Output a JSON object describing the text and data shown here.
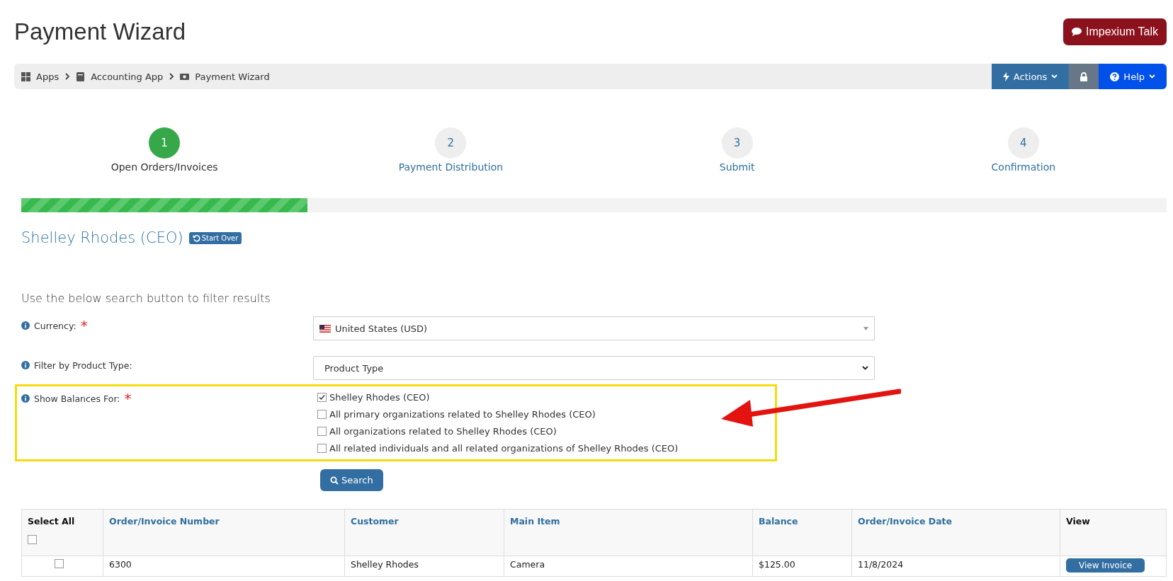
{
  "page_title": "Payment Wizard",
  "talk_button": {
    "label": "Impexium Talk"
  },
  "breadcrumb": [
    {
      "label": "Apps"
    },
    {
      "label": "Accounting App"
    },
    {
      "label": "Payment Wizard"
    }
  ],
  "toolbar": {
    "actions": "Actions",
    "help": "Help"
  },
  "steps": [
    {
      "number": "1",
      "label": "Open Orders/Invoices",
      "selected": true
    },
    {
      "number": "2",
      "label": "Payment Distribution",
      "selected": false
    },
    {
      "number": "3",
      "label": "Submit",
      "selected": false
    },
    {
      "number": "4",
      "label": "Confirmation",
      "selected": false
    }
  ],
  "progress": {
    "level": 0.25
  },
  "customer_heading": "Shelley Rhodes (CEO)",
  "start_over": "Start Over",
  "instruction": "Use the below search button to filter results",
  "currency": {
    "label": "Currency:",
    "required_mark": "*",
    "value": "United States (USD)"
  },
  "product_type": {
    "label": "Filter by Product Type:",
    "value": "Product Type"
  },
  "show_balances": {
    "label": "Show Balances For:",
    "required_mark": "*",
    "options": [
      {
        "label": "Shelley Rhodes (CEO)",
        "checked": true
      },
      {
        "label": "All primary organizations related to Shelley Rhodes (CEO)",
        "checked": false
      },
      {
        "label": "All organizations related to Shelley Rhodes (CEO)",
        "checked": false
      },
      {
        "label": "All related individuals and all related organizations of Shelley Rhodes (CEO)",
        "checked": false
      }
    ]
  },
  "search_button": "Search",
  "table": {
    "select_all": {
      "label": "Select All",
      "checked": false
    },
    "columns": [
      "Order/Invoice Number",
      "Customer",
      "Main Item",
      "Balance",
      "Order/Invoice Date"
    ],
    "view_column": "View",
    "rows": [
      {
        "checked": false,
        "cells": [
          "6300",
          "Shelley Rhodes",
          "Camera",
          "$125.00",
          "11/8/2024"
        ],
        "button": "View Invoice"
      }
    ]
  }
}
